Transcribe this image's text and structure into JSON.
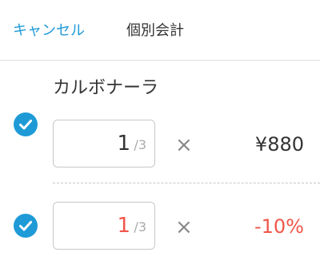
{
  "header": {
    "cancel_label": "キャンセル",
    "title": "個別会計"
  },
  "item": {
    "name": "カルボナーラ"
  },
  "rows": [
    {
      "checked": true,
      "quantity": "1",
      "total": "/3",
      "times": "×",
      "value": "¥880",
      "quantity_color": "#333333",
      "value_color": "#333333"
    },
    {
      "checked": true,
      "quantity": "1",
      "total": "/3",
      "times": "×",
      "value": "-10%",
      "quantity_color": "#f0564a",
      "value_color": "#f0564a"
    }
  ],
  "colors": {
    "accent": "#1e9bd7",
    "discount": "#f0564a"
  }
}
